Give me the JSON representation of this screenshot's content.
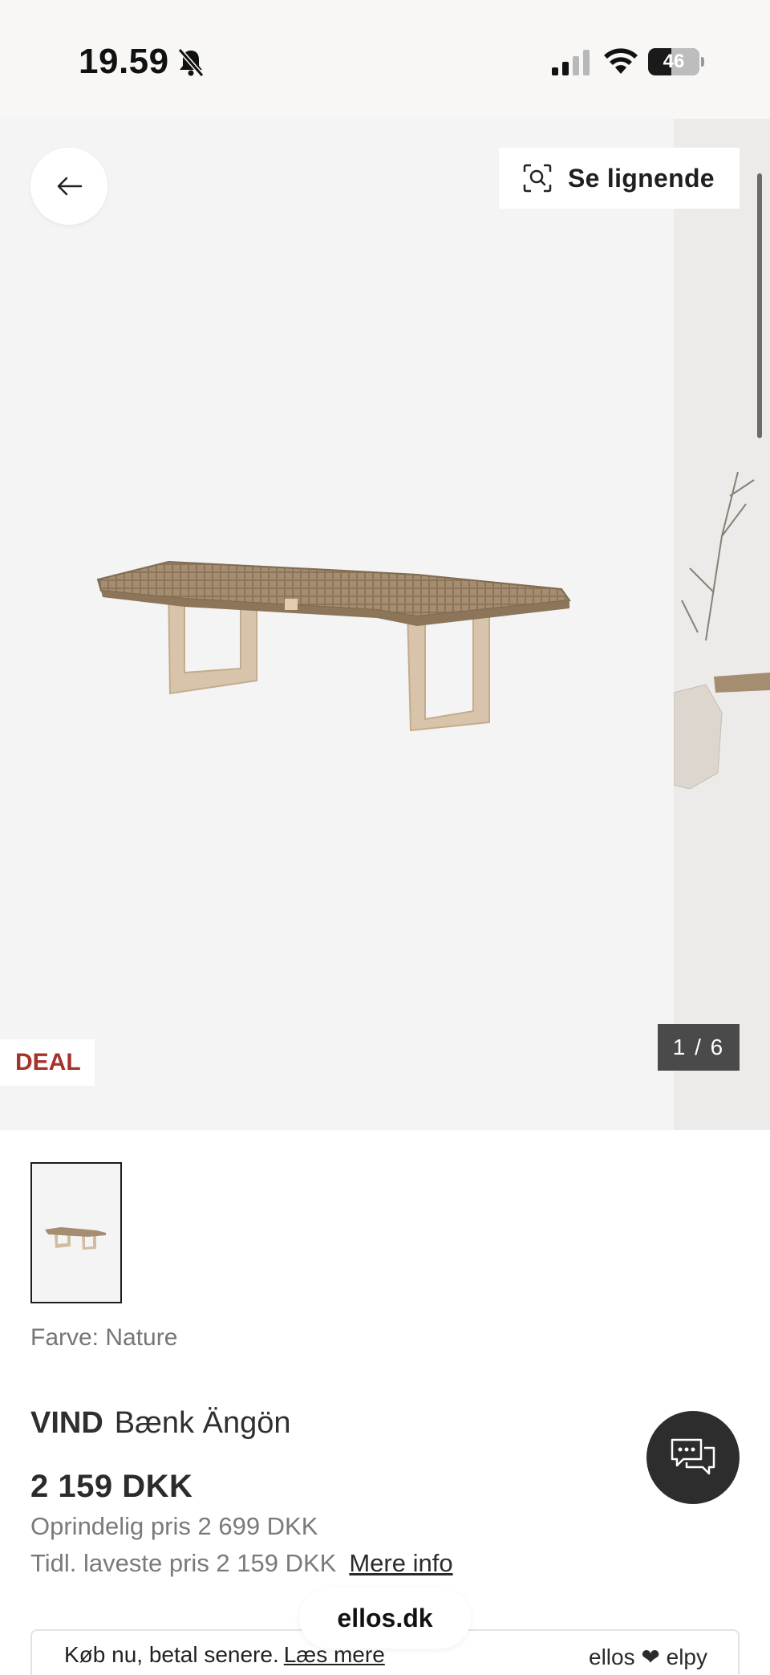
{
  "status_bar": {
    "time": "19.59",
    "battery_level": "46",
    "battery_fraction": 0.46
  },
  "gallery": {
    "similar_label": "Se lignende",
    "deal_badge": "DEAL",
    "page_counter": "1 / 6"
  },
  "product": {
    "color_label": "Farve: Nature",
    "brand": "VIND",
    "name": "Bænk Ängön",
    "price": "2 159 DKK",
    "original_price": "Oprindelig pris 2 699 DKK",
    "lowest_price": "Tidl. laveste pris 2 159 DKK",
    "more_info": "Mere info"
  },
  "payment": {
    "text": "Køb nu, betal senere.",
    "read_more": "Læs mere",
    "logo": "ellos ❤ elpy"
  },
  "browser": {
    "domain": "ellos.dk"
  },
  "colors": {
    "deal_red": "#a6322c",
    "dark": "#2d2d2d"
  },
  "icons": {
    "back": "arrow-left-icon",
    "similar": "visual-search-icon",
    "chat": "chat-bubbles-icon"
  }
}
